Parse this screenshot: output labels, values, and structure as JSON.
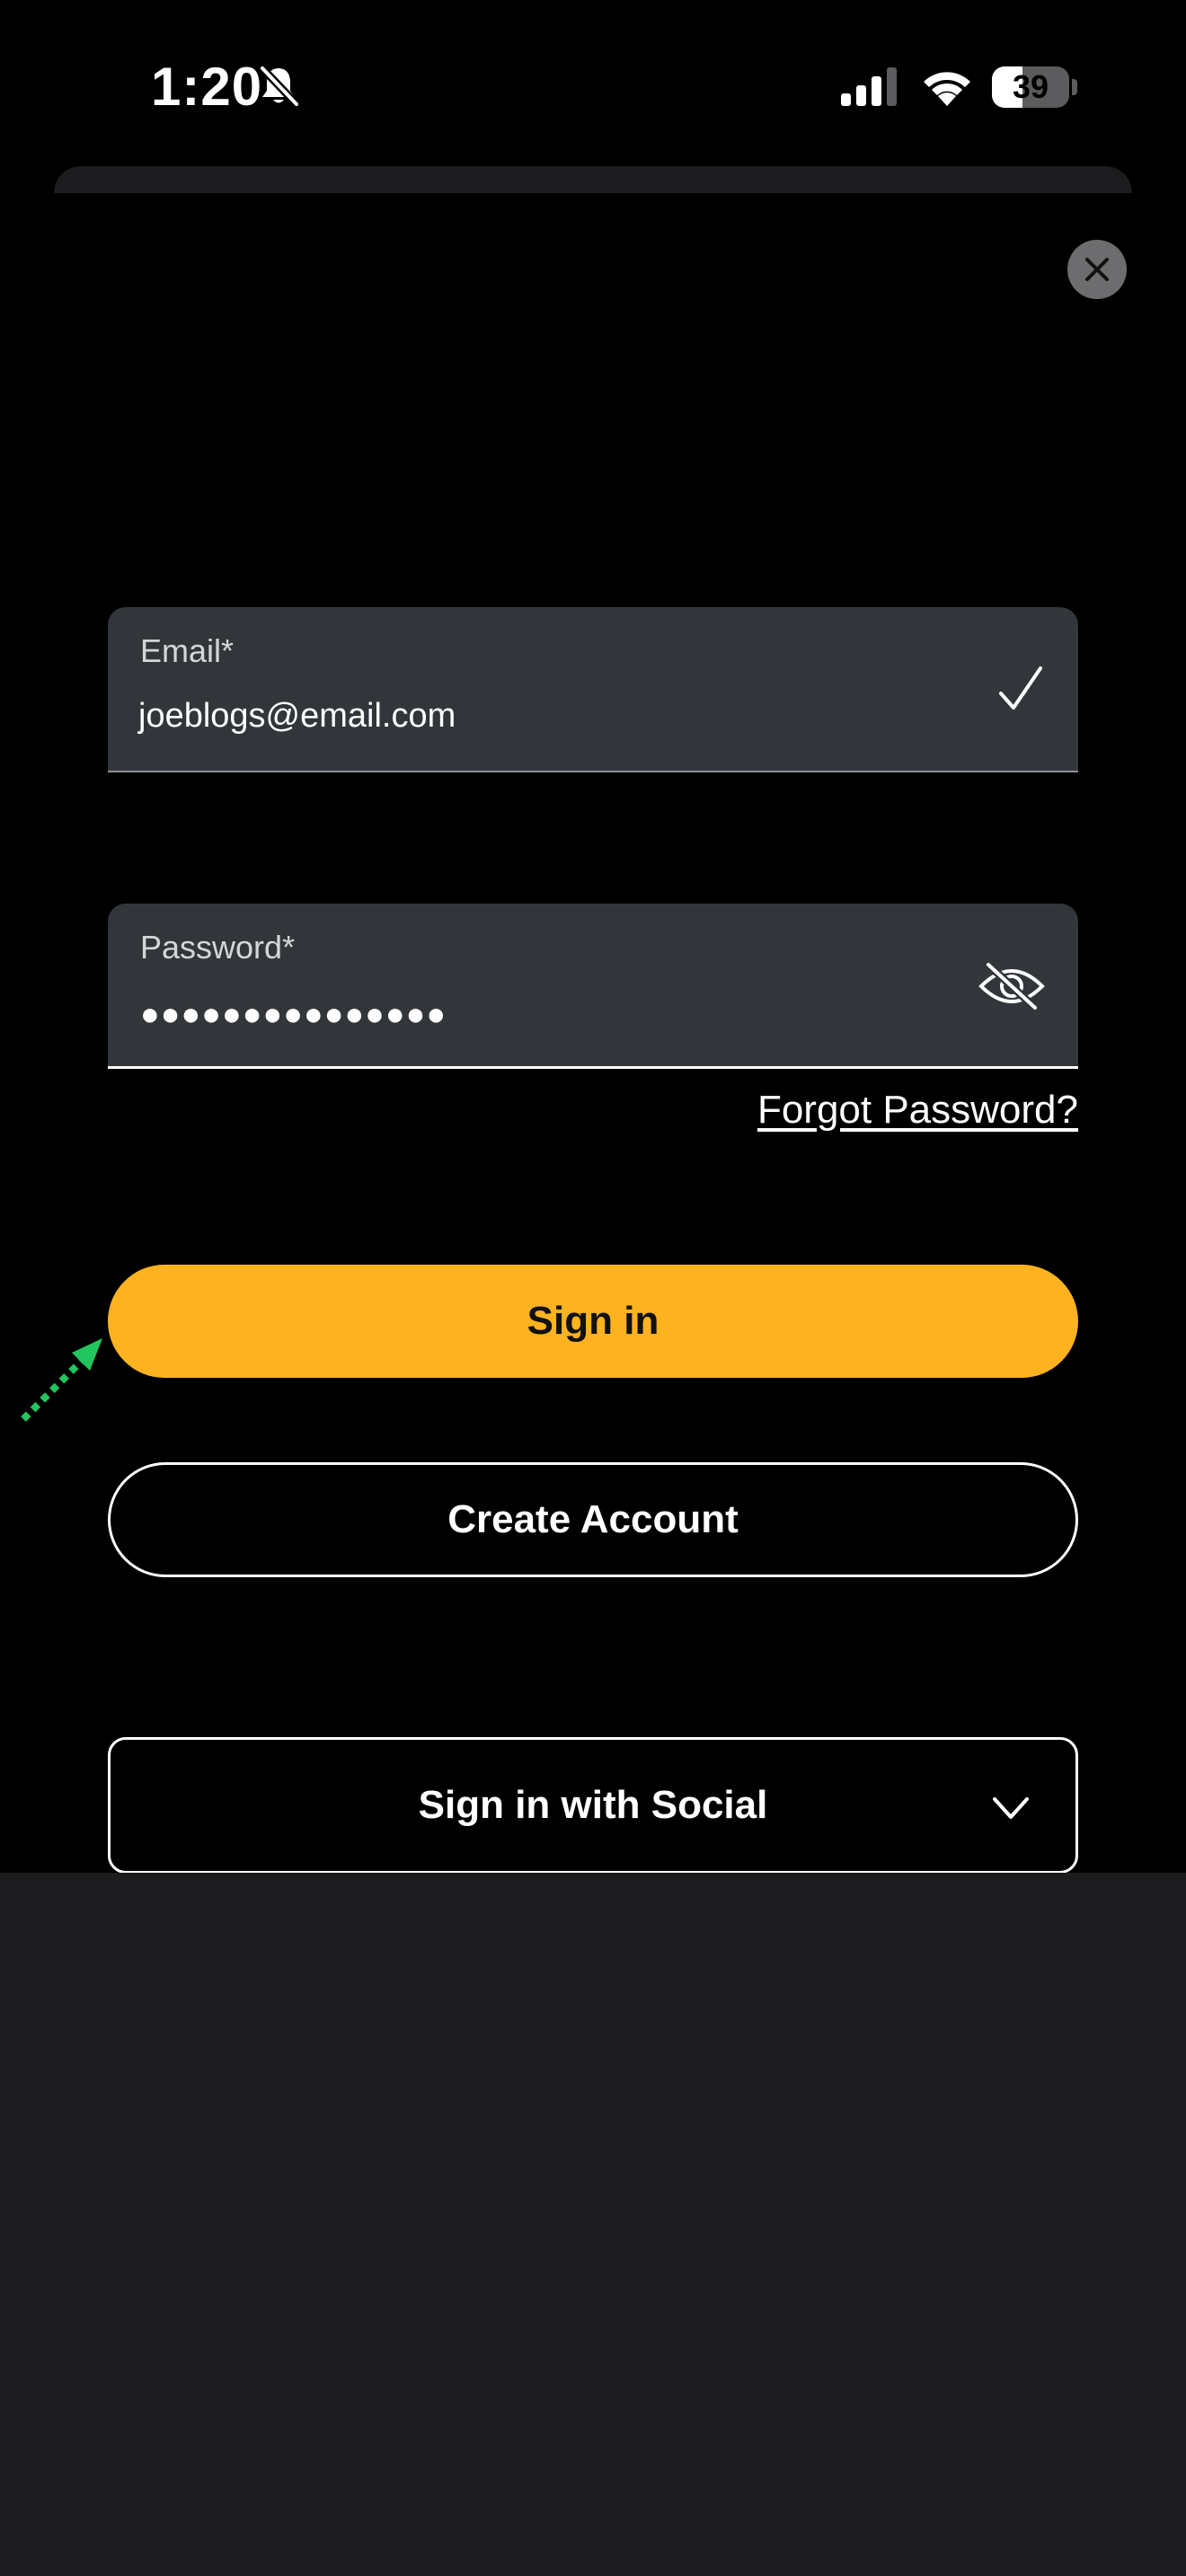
{
  "status_bar": {
    "time": "1:20",
    "battery_percent": "39",
    "battery_level": 0.39,
    "icons": [
      "bell-slash-icon",
      "cellular-signal-icon",
      "wifi-icon",
      "battery-icon"
    ]
  },
  "modal": {
    "close_icon": "close-icon"
  },
  "email_field": {
    "label": "Email*",
    "value": "joeblogs@email.com",
    "status_icon": "checkmark-icon"
  },
  "password_field": {
    "label": "Password*",
    "masked_value": "●●●●●●●●●●●●●●●",
    "toggle_icon": "eye-slash-icon"
  },
  "links": {
    "forgot_password": "Forgot Password?"
  },
  "buttons": {
    "sign_in": "Sign in",
    "create_account": "Create Account",
    "sign_in_social": "Sign in with Social"
  },
  "colors": {
    "accent": "#fdb21f",
    "field_background": "#32363a",
    "background": "#000000",
    "lower_background": "#1c1c1e",
    "annotation_arrow": "#22c55e"
  }
}
